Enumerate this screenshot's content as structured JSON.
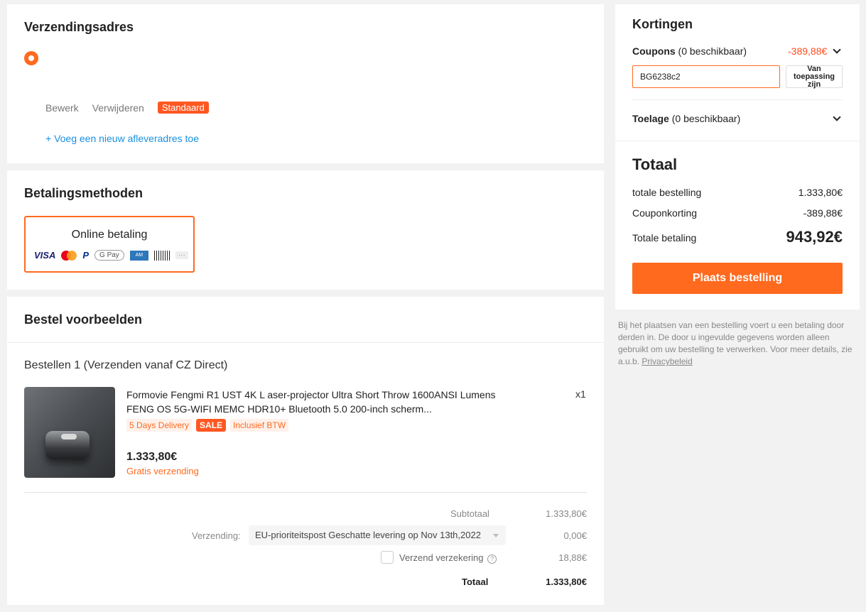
{
  "address": {
    "title": "Verzendingsadres",
    "edit": "Bewerk",
    "delete": "Verwijderen",
    "default_badge": "Standaard",
    "add_new": "+ Voeg een nieuw afleveradres toe"
  },
  "payment": {
    "title": "Betalingsmethoden",
    "option_label": "Online betaling",
    "icons": [
      "visa-icon",
      "mastercard-icon",
      "paypal-icon",
      "gpay-icon",
      "amex-icon",
      "boleto-icon",
      "more-icon"
    ],
    "visa_text": "VISA",
    "gpay_text": "G Pay",
    "more_text": "···"
  },
  "orders": {
    "title": "Bestel voorbeelden",
    "batch_label": "Bestellen 1 (Verzenden vanaf CZ Direct)",
    "item": {
      "name": "Formovie Fengmi R1 UST 4K L aser-projector Ultra Short Throw 1600ANSI Lumens FENG OS 5G-WIFI MEMC HDR10+ Bluetooth 5.0 200-inch scherm...",
      "qty": "x1",
      "tag_delivery": "5 Days Delivery",
      "tag_sale": "SALE",
      "tag_vat": "Inclusief BTW",
      "price": "1.333,80€",
      "free_shipping": "Gratis verzending"
    },
    "summary": {
      "subtotal_label": "Subtotaal",
      "subtotal_value": "1.333,80€",
      "shipping_label": "Verzending:",
      "shipping_option": "EU-prioriteitspost Geschatte levering op Nov 13th,2022",
      "shipping_value": "0,00€",
      "insurance_label": "Verzend verzekering",
      "insurance_value": "18,88€",
      "insurance_checked": false,
      "total_label": "Totaal",
      "total_value": "1.333,80€"
    }
  },
  "discounts": {
    "title": "Kortingen",
    "coupons_label": "Coupons",
    "coupons_count": "(0 beschikbaar)",
    "coupons_value": "-389,88€",
    "coupon_code": "BG6238c2",
    "apply_label": "Van toepassing zijn",
    "allowance_label": "Toelage",
    "allowance_count": "(0 beschikbaar)"
  },
  "total": {
    "title": "Totaal",
    "order_total_label": "totale bestelling",
    "order_total_value": "1.333,80€",
    "coupon_discount_label": "Couponkorting",
    "coupon_discount_value": "-389,88€",
    "payment_total_label": "Totale betaling",
    "payment_total_value": "943,92€",
    "place_order": "Plaats bestelling"
  },
  "note": {
    "text": "Bij het plaatsen van een bestelling voert u een betaling door derden in. De door u ingevulde gegevens worden alleen gebruikt om uw bestelling te verwerken. Voor meer details, zie a.u.b.",
    "privacy_link": "Privacybeleid"
  },
  "colors": {
    "accent": "#ff6a1f",
    "sale": "#ff5722",
    "link": "#1a8fe0"
  }
}
